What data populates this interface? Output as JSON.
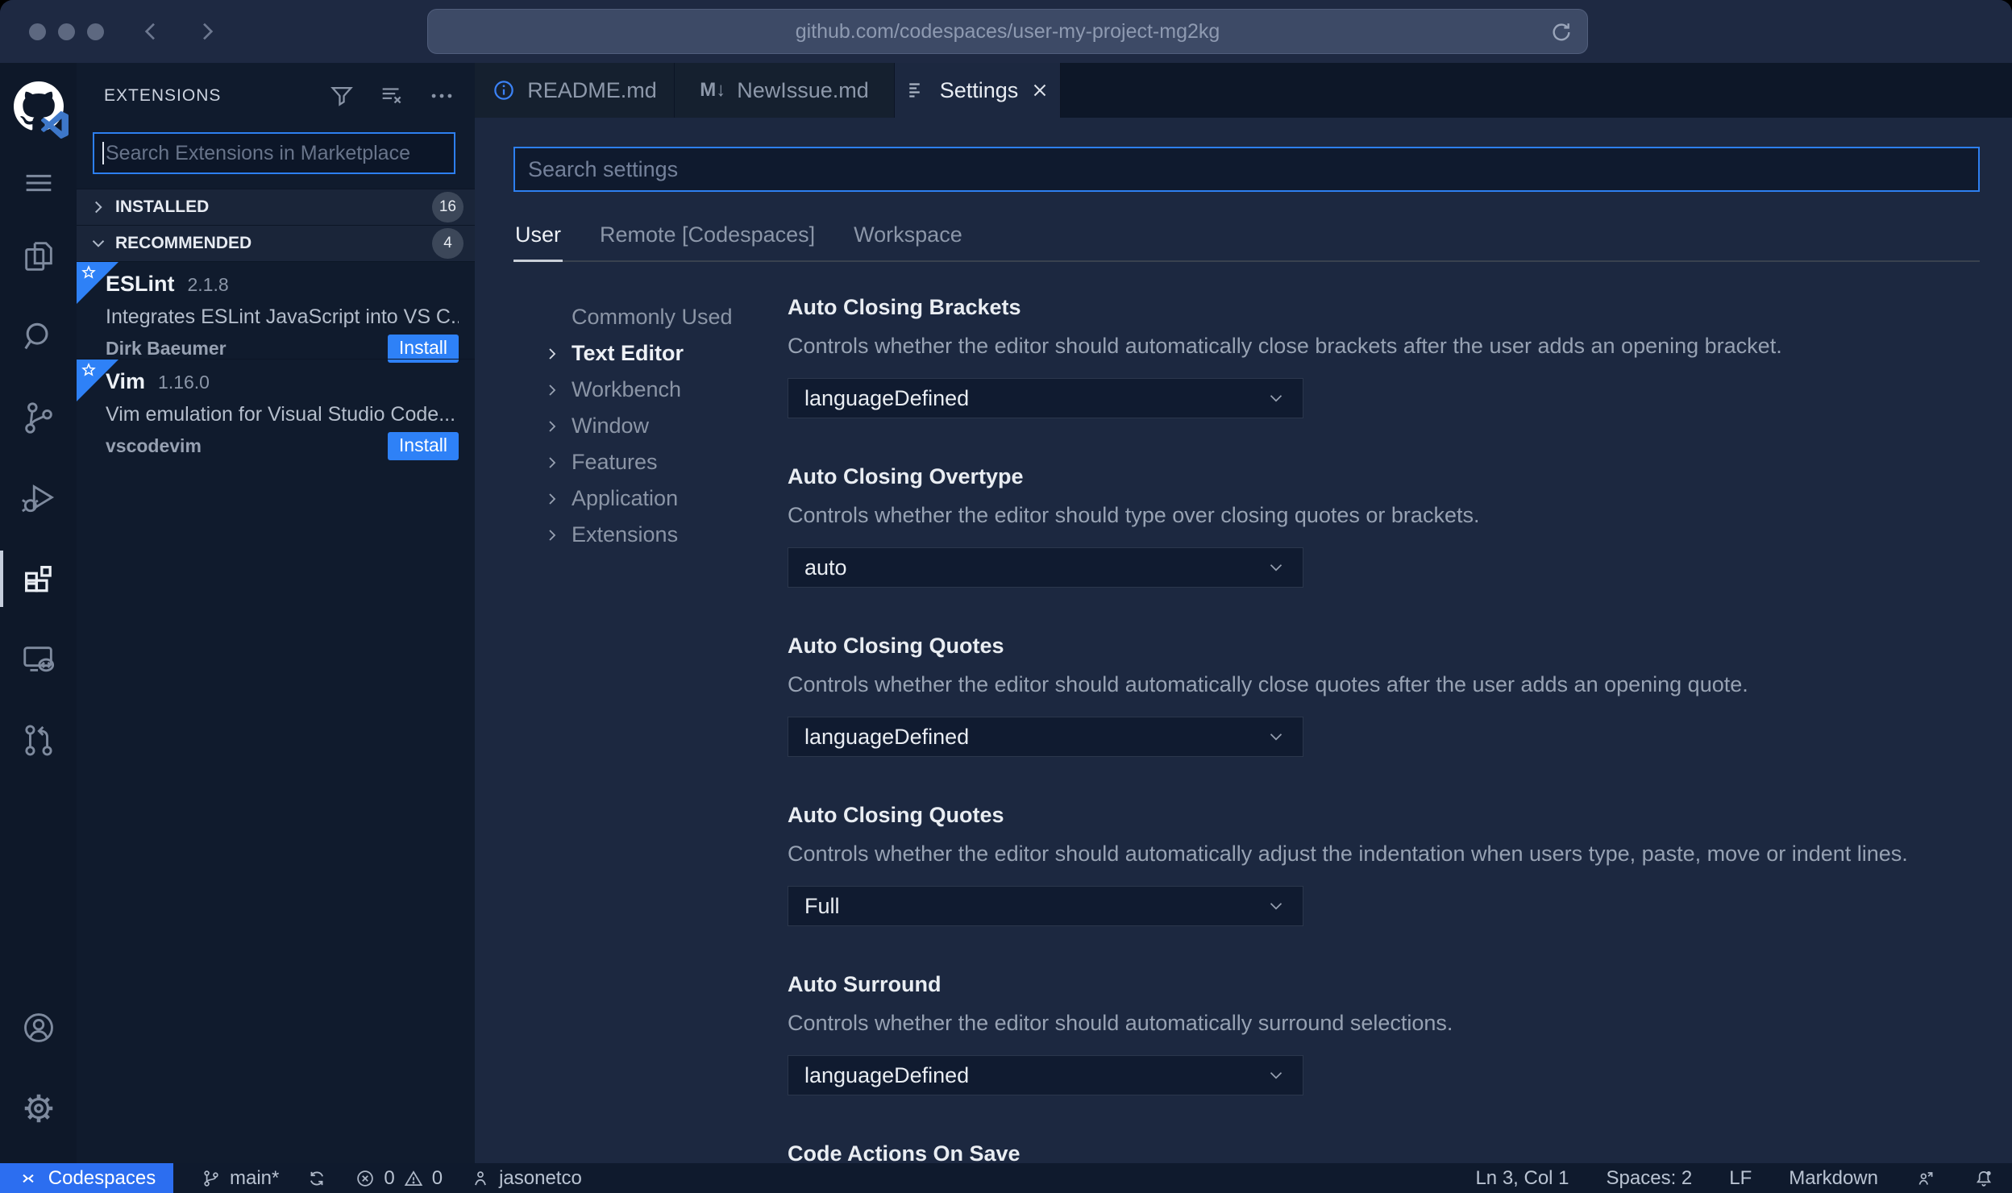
{
  "browser": {
    "url": "github.com/codespaces/user-my-project-mg2kg"
  },
  "sidebar": {
    "title": "EXTENSIONS",
    "search_placeholder": "Search Extensions in Marketplace",
    "sections": [
      {
        "label": "INSTALLED",
        "count": "16"
      },
      {
        "label": "RECOMMENDED",
        "count": "4"
      }
    ],
    "extensions": [
      {
        "name": "ESLint",
        "version": "2.1.8",
        "description": "Integrates ESLint JavaScript into VS C...",
        "author": "Dirk Baeumer",
        "action": "Install"
      },
      {
        "name": "Vim",
        "version": "1.16.0",
        "description": "Vim emulation for Visual Studio Code...",
        "author": "vscodevim",
        "action": "Install"
      }
    ]
  },
  "editor_tabs": [
    {
      "label": "README.md"
    },
    {
      "label": "NewIssue.md",
      "icon_glyph": "M↓"
    },
    {
      "label": "Settings"
    }
  ],
  "settings": {
    "search_placeholder": "Search settings",
    "scopes": [
      "User",
      "Remote [Codespaces]",
      "Workspace"
    ],
    "toc": [
      "Commonly Used",
      "Text Editor",
      "Workbench",
      "Window",
      "Features",
      "Application",
      "Extensions"
    ],
    "items": [
      {
        "title": "Auto Closing Brackets",
        "description": "Controls whether the editor should automatically close brackets after the user adds an opening bracket.",
        "value": "languageDefined"
      },
      {
        "title": "Auto Closing Overtype",
        "description": "Controls whether the editor should type over closing quotes or brackets.",
        "value": "auto"
      },
      {
        "title": "Auto Closing Quotes",
        "description": "Controls whether the editor should automatically close quotes after the user adds an opening quote.",
        "value": "languageDefined"
      },
      {
        "title": "Auto Closing Quotes",
        "description": "Controls whether the editor should automatically adjust the indentation when users type, paste, move or indent lines.",
        "value": "Full"
      },
      {
        "title": "Auto Surround",
        "description": "Controls whether the editor should automatically surround selections.",
        "value": "languageDefined"
      },
      {
        "title": "Code Actions On Save"
      }
    ]
  },
  "status_bar": {
    "codespaces_label": "Codespaces",
    "branch": "main*",
    "error_count": "0",
    "warning_count": "0",
    "user": "jasonetco",
    "line_col": "Ln 3, Col 1",
    "indentation": "Spaces: 2",
    "eol": "LF",
    "language": "Markdown"
  },
  "colors": {
    "accent_blue": "#2e81f7",
    "codespaces_blue": "#2c6ef0",
    "editor_bg": "#1c2840",
    "sidebar_bg": "#101b2d",
    "activity_bar_bg": "#0e1829",
    "chrome_bg": "#1e2942",
    "status_bg": "#0f1a2d"
  }
}
